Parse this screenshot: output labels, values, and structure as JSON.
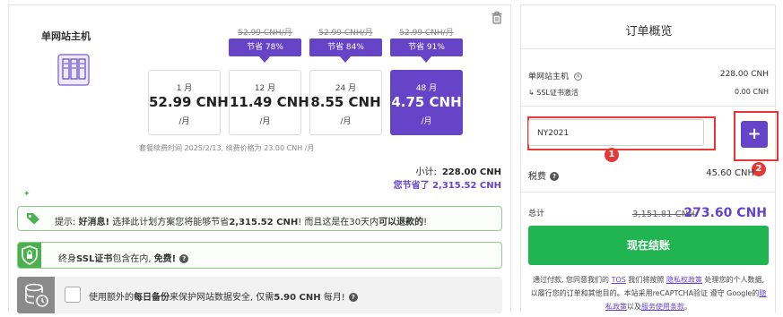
{
  "product": {
    "title": "单网站主机",
    "renew_note": "套餐续费时间 2025/2/13, 续费价格为 23.00 CNH /月"
  },
  "plans": [
    {
      "months": "1 月",
      "price": "52.99 CNH",
      "unit": "/月",
      "original": "",
      "save": "",
      "selected": false
    },
    {
      "months": "12 月",
      "price": "11.49 CNH",
      "unit": "/月",
      "original": "52.99 CNH/月",
      "save": "节省 78%",
      "selected": false
    },
    {
      "months": "24 月",
      "price": "8.55 CNH",
      "unit": "/月",
      "original": "52.99 CNH/月",
      "save": "节省 84%",
      "selected": false
    },
    {
      "months": "48 月",
      "price": "4.75 CNH",
      "unit": "/月",
      "original": "52.99 CNH/月",
      "save": "节省 91%",
      "selected": true
    }
  ],
  "subtotal": {
    "label": "小计:",
    "value": "228.00 CNH",
    "saved": "您节省了 2,315.52 CNH"
  },
  "notices": {
    "tip_prefix": "提示: ",
    "tip_bold1": "好消息!",
    "tip_mid": " 选择此计划方案您将能够节省",
    "tip_bold2": "2,315.52 CNH",
    "tip_mid2": "! 而且这是在30天内",
    "tip_bold3": "可以退款的",
    "tip_end": "!",
    "ssl_prefix": "终身",
    "ssl_bold": "SSL证书",
    "ssl_mid": "包含在内, ",
    "ssl_free": "免费!",
    "backup_pre": "使用额外的",
    "backup_bold": "每日备份",
    "backup_mid": "来保护网站数据安全, 仅需",
    "backup_price": "5.90 CNH",
    "backup_end": " 每月!"
  },
  "order": {
    "title": "订单概览",
    "item_label": "单网站主机",
    "item_value": "228.00 CNH",
    "ssl_label": "↳ SSL证书激活",
    "ssl_value": "0.00 CNH",
    "coupon_value": "NY2021",
    "add_label": "+",
    "tax_label": "税费",
    "tax_value": "45.60 CNH",
    "total_label": "总计",
    "total_old": "3,151.81 CNH",
    "total_new": "273.60 CNH",
    "checkout_label": "现在结账"
  },
  "legal": {
    "p1": "通过付款, 您同意我们的 ",
    "tos": "TOS",
    "p2": " 我们将按照 ",
    "privacy": "隐私权政策",
    "p3": " 处理您的个人数据, 以履行您的订单和其他目的。本站采用reCAPTCHA验证 遵守 Google的",
    "gprivacy": "隐私政策",
    "p4": "以及",
    "gterms": "服务使用条款",
    "p5": "。"
  },
  "annotations": {
    "one": "1",
    "two": "2"
  },
  "colors": {
    "accent": "#6544c8",
    "green": "#21b552",
    "red": "#e53935"
  }
}
